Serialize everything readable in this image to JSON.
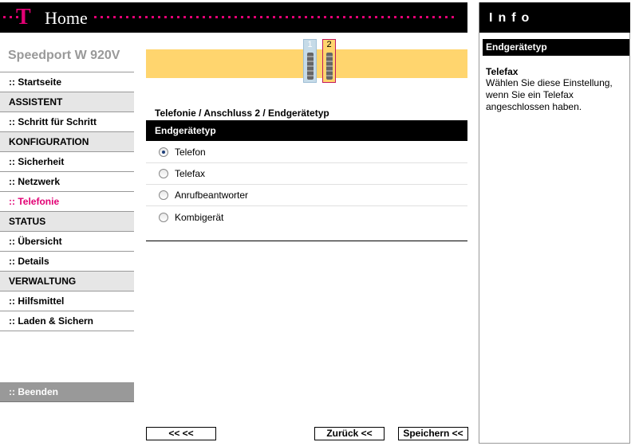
{
  "header": {
    "logo_letter": "T",
    "title": "Home"
  },
  "product_name": "Speedport W 920V",
  "nav": [
    {
      "label": ":: Startseite",
      "type": "link",
      "active": false
    },
    {
      "label": "ASSISTENT",
      "type": "section"
    },
    {
      "label": ":: Schritt für Schritt",
      "type": "link",
      "active": false
    },
    {
      "label": "KONFIGURATION",
      "type": "section"
    },
    {
      "label": ":: Sicherheit",
      "type": "link",
      "active": false
    },
    {
      "label": ":: Netzwerk",
      "type": "link",
      "active": false
    },
    {
      "label": ":: Telefonie",
      "type": "link",
      "active": true
    },
    {
      "label": "STATUS",
      "type": "section"
    },
    {
      "label": ":: Übersicht",
      "type": "link",
      "active": false
    },
    {
      "label": ":: Details",
      "type": "link",
      "active": false
    },
    {
      "label": "VERWALTUNG",
      "type": "section"
    },
    {
      "label": ":: Hilfsmittel",
      "type": "link",
      "active": false
    },
    {
      "label": ":: Laden & Sichern",
      "type": "link",
      "active": false
    }
  ],
  "logout_label": ":: Beenden",
  "steps": {
    "step1": "1",
    "step2": "2"
  },
  "breadcrumb": "Telefonie / Anschluss 2 / Endgerätetyp",
  "panel_title": "Endgerätetyp",
  "options": [
    {
      "label": "Telefon",
      "checked": true
    },
    {
      "label": "Telefax",
      "checked": false
    },
    {
      "label": "Anrufbeantworter",
      "checked": false
    },
    {
      "label": "Kombigerät",
      "checked": false
    }
  ],
  "buttons": {
    "first": "<< <<",
    "back": "Zurück <<",
    "save": "Speichern <<"
  },
  "info": {
    "title": "Info",
    "subtitle": "Endgerätetyp",
    "text_title": "Telefax",
    "text": "Wählen Sie diese Einstellung, wenn Sie ein Telefax angeschlossen haben."
  },
  "colors": {
    "magenta": "#e20074",
    "band": "#ffd56e",
    "black": "#000000",
    "section_bg": "#e6e6e6"
  }
}
